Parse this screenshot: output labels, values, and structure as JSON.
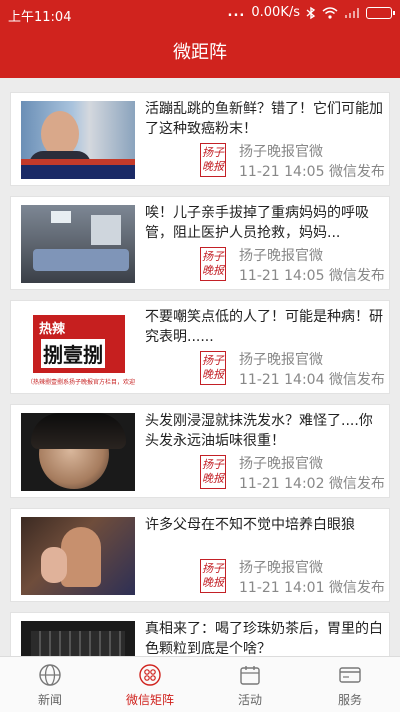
{
  "status_bar": {
    "time": "上午11:04",
    "net_speed": "0.00K/s",
    "dots": "..."
  },
  "header": {
    "title": "微距阵"
  },
  "articles": [
    {
      "title": "活蹦乱跳的鱼新鲜？错了！它们可能加了这种致癌粉末！",
      "source": "扬子晚报官微",
      "time": "11-21 14:05",
      "channel": "微信发布",
      "logo_text": "扬子晚报"
    },
    {
      "title": "唉！儿子亲手拔掉了重病妈妈的呼吸管，阻止医护人员抢救，妈妈...",
      "source": "扬子晚报官微",
      "time": "11-21 14:05",
      "channel": "微信发布",
      "logo_text": "扬子晚报"
    },
    {
      "title": "不要嘲笑点低的人了！可能是种病！研究表明......",
      "source": "扬子晚报官微",
      "time": "11-21 14:04",
      "channel": "微信发布",
      "logo_text": "扬子晚报",
      "thumb_text": {
        "top": "热辣",
        "main": "捌壹捌",
        "caption": "（热辣捌壹捌系扬子晚报官方栏目，欢迎关注）"
      }
    },
    {
      "title": "头发刚浸湿就抹洗发水？难怪了....你头发永远油垢味很重！",
      "source": "扬子晚报官微",
      "time": "11-21 14:02",
      "channel": "微信发布",
      "logo_text": "扬子晚报"
    },
    {
      "title": "许多父母在不知不觉中培养白眼狼",
      "source": "扬子晚报官微",
      "time": "11-21 14:01",
      "channel": "微信发布",
      "logo_text": "扬子晚报"
    },
    {
      "title": "真相来了：喝了珍珠奶茶后，胃里的白色颗粒到底是个啥？",
      "source": "",
      "time": "",
      "channel": "",
      "logo_text": ""
    }
  ],
  "tabs": [
    {
      "label": "新闻",
      "icon": "globe-icon",
      "active": false
    },
    {
      "label": "微信矩阵",
      "icon": "matrix-icon",
      "active": true
    },
    {
      "label": "活动",
      "icon": "calendar-icon",
      "active": false
    },
    {
      "label": "服务",
      "icon": "card-icon",
      "active": false
    }
  ],
  "colors": {
    "brand_red": "#d0231e",
    "meta_gray": "#888888"
  }
}
